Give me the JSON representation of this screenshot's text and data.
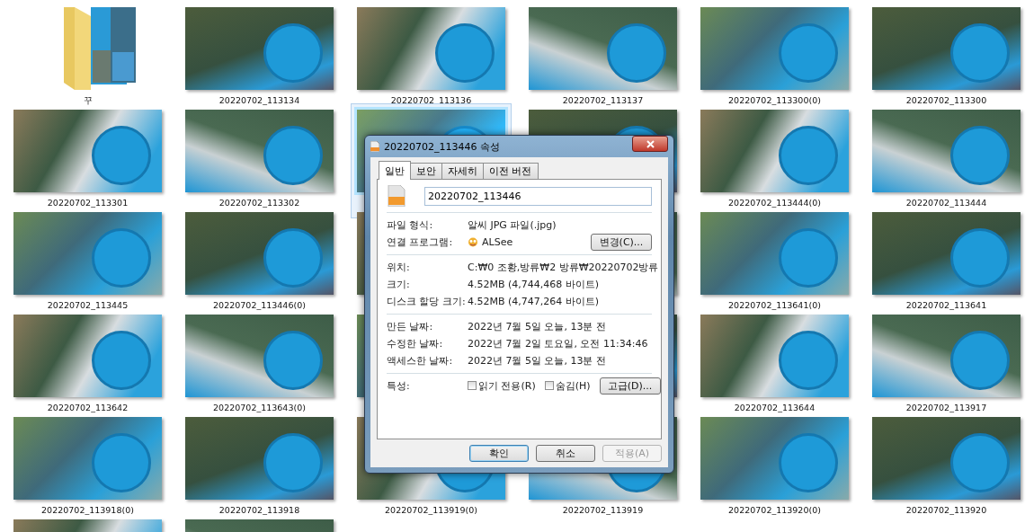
{
  "items": [
    {
      "kind": "folder",
      "label": "꾸",
      "selected": false
    },
    {
      "kind": "photo",
      "label": "20220702_113134",
      "selected": false
    },
    {
      "kind": "photo",
      "label": "20220702_113136",
      "selected": false
    },
    {
      "kind": "photo",
      "label": "20220702_113137",
      "selected": false
    },
    {
      "kind": "photo",
      "label": "20220702_113300(0)",
      "selected": false
    },
    {
      "kind": "photo",
      "label": "20220702_113300",
      "selected": false
    },
    {
      "kind": "photo",
      "label": "20220702_113301",
      "selected": false
    },
    {
      "kind": "photo",
      "label": "20220702_113302",
      "selected": false
    },
    {
      "kind": "photo",
      "selected": true
    },
    {
      "kind": "photo",
      "selected": false
    },
    {
      "kind": "photo",
      "label": "20220702_113444(0)",
      "selected": false
    },
    {
      "kind": "photo",
      "label": "20220702_113444",
      "selected": false
    },
    {
      "kind": "photo",
      "label": "20220702_113445",
      "selected": false
    },
    {
      "kind": "photo",
      "label": "20220702_113446(0)",
      "selected": false
    },
    {
      "kind": "photo",
      "selected": false
    },
    {
      "kind": "photo",
      "selected": false
    },
    {
      "kind": "photo",
      "label": "20220702_113641(0)",
      "selected": false
    },
    {
      "kind": "photo",
      "label": "20220702_113641",
      "selected": false
    },
    {
      "kind": "photo",
      "label": "20220702_113642",
      "selected": false
    },
    {
      "kind": "photo",
      "label": "20220702_113643(0)",
      "selected": false
    },
    {
      "kind": "photo",
      "selected": false
    },
    {
      "kind": "photo",
      "selected": false
    },
    {
      "kind": "photo",
      "label": "20220702_113644",
      "selected": false
    },
    {
      "kind": "photo",
      "label": "20220702_113917",
      "selected": false
    },
    {
      "kind": "photo",
      "label": "20220702_113918(0)",
      "selected": false
    },
    {
      "kind": "photo",
      "label": "20220702_113918",
      "selected": false
    },
    {
      "kind": "photo",
      "label": "20220702_113919(0)",
      "selected": false
    },
    {
      "kind": "photo",
      "label": "20220702_113919",
      "selected": false
    },
    {
      "kind": "photo",
      "label": "20220702_113920(0)",
      "selected": false
    },
    {
      "kind": "photo",
      "label": "20220702_113920",
      "selected": false
    },
    {
      "kind": "photo",
      "selected": false
    },
    {
      "kind": "photo",
      "selected": false
    }
  ],
  "dialog": {
    "title": "20220702_113446 속성",
    "tabs": [
      {
        "label": "일반",
        "selected": true
      },
      {
        "label": "보안",
        "selected": false
      },
      {
        "label": "자세히",
        "selected": false
      },
      {
        "label": "이전 버전",
        "selected": false
      }
    ],
    "file_name": "20220702_113446",
    "file_type": {
      "label": "파일 형식:",
      "value": "알씨 JPG 파일(.jpg)"
    },
    "opens_with": {
      "label": "연결 프로그램:",
      "value": "ALSee",
      "button": "변경(C)..."
    },
    "info": [
      {
        "label": "위치:",
        "value": "C:₩0 조황,방류₩2 방류₩20220702방류"
      },
      {
        "label": "크기:",
        "value": "4.52MB (4,744,468 바이트)"
      },
      {
        "label": "디스크 할당 크기:",
        "value": "4.52MB (4,747,264 바이트)"
      }
    ],
    "dates": [
      {
        "label": "만든 날짜:",
        "value": "2022년 7월 5일 오늘, 13분 전"
      },
      {
        "label": "수정한 날짜:",
        "value": "2022년 7월 2일 토요일, 오전 11:34:46"
      },
      {
        "label": "액세스한 날짜:",
        "value": "2022년 7월 5일 오늘, 13분 전"
      }
    ],
    "attributes": {
      "label": "특성:",
      "options": [
        {
          "label": "읽기 전용(R)",
          "checked": false
        },
        {
          "label": "숨김(H)",
          "checked": false
        }
      ],
      "button": "고급(D)..."
    },
    "buttons": [
      {
        "label": "확인",
        "disabled": false,
        "default": true
      },
      {
        "label": "취소",
        "disabled": false,
        "default": false
      },
      {
        "label": "적용(A)",
        "disabled": true,
        "default": false
      }
    ]
  }
}
